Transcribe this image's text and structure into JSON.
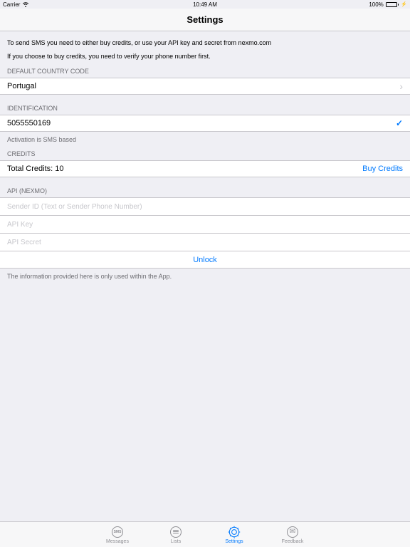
{
  "statusBar": {
    "carrier": "Carrier",
    "time": "10:49 AM",
    "battery": "100%"
  },
  "nav": {
    "title": "Settings"
  },
  "info": {
    "line1": "To send SMS you need to either buy credits, or use your API key and secret from nexmo.com",
    "line2": "If you choose to buy credits, you need to verify your phone number first."
  },
  "sections": {
    "defaultCountry": {
      "header": "DEFAULT COUNTRY CODE",
      "value": "Portugal"
    },
    "identification": {
      "header": "IDENTIFICATION",
      "value": "5055550169",
      "footer": "Activation is SMS based"
    },
    "credits": {
      "header": "CREDITS",
      "value": "Total Credits: 10",
      "buy": "Buy Credits"
    },
    "api": {
      "header": "API (NEXMO)",
      "senderPlaceholder": "Sender ID (Text or Sender Phone Number)",
      "keyPlaceholder": "API Key",
      "secretPlaceholder": "API Secret",
      "unlock": "Unlock"
    },
    "privacy": "The information provided here is only used within the App."
  },
  "tabs": {
    "messages": "Messages",
    "lists": "Lists",
    "settings": "Settings",
    "feedback": "Feedback"
  }
}
